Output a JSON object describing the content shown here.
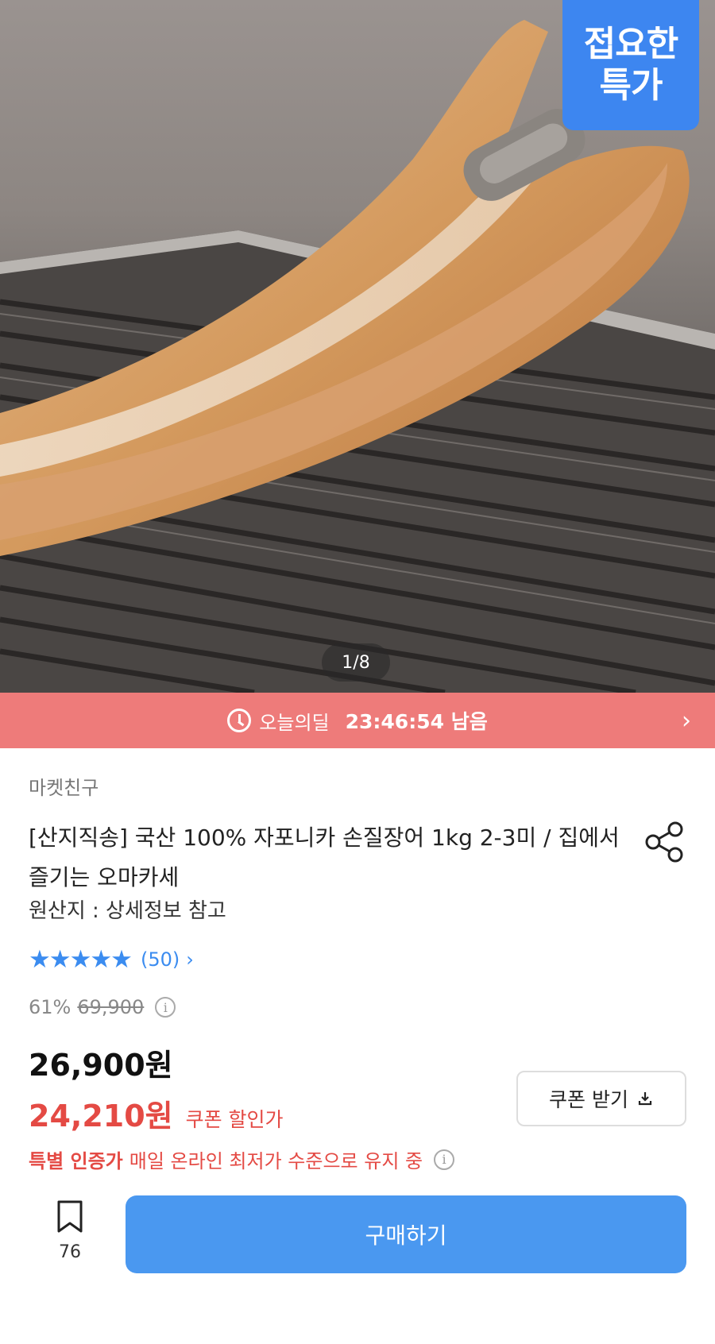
{
  "hero": {
    "badge_line1": "접요한",
    "badge_line2": "특가",
    "image_counter": "1/8"
  },
  "deal": {
    "label": "오늘의딜",
    "time_remaining": "23:46:54 남음"
  },
  "product": {
    "seller": "마켓친구",
    "title": "[산지직송] 국산 100% 자포니카 손질장어 1kg 2-3미 / 집에서 즐기는 오마카세",
    "origin": "원산지 : 상세정보 참고",
    "rating_stars": 5,
    "rating_count": "(50)",
    "discount_rate": "61%",
    "original_price": "69,900",
    "price": "26,900원",
    "coupon_price": "24,210원",
    "coupon_price_label": "쿠폰 할인가",
    "coupon_button_label": "쿠폰 받기",
    "cert_label": "특별 인증가",
    "cert_desc": "매일 온라인 최저가 수준으로 유지 중"
  },
  "actions": {
    "bookmark_count": "76",
    "buy_label": "구매하기"
  },
  "colors": {
    "accent_blue": "#4a98f0",
    "deal_bar": "#ee7b7a",
    "price_red": "#e44a44"
  }
}
